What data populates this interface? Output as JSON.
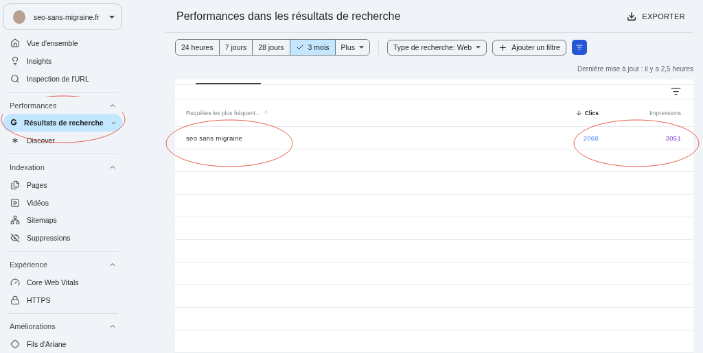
{
  "property": {
    "name": "seo-sans-migraine.fr"
  },
  "sidebar": {
    "top_items": [
      {
        "label": "Vue d'ensemble",
        "selected": false
      },
      {
        "label": "Insights",
        "selected": false
      },
      {
        "label": "Inspection de l'URL",
        "selected": false
      }
    ],
    "sections": [
      {
        "title": "Performances",
        "expanded": true,
        "items": [
          {
            "label": "Résultats de recherche",
            "selected": true
          },
          {
            "label": "Discover",
            "selected": false
          }
        ]
      },
      {
        "title": "Indexation",
        "expanded": true,
        "items": [
          {
            "label": "Pages",
            "selected": false
          },
          {
            "label": "Vidéos",
            "selected": false
          },
          {
            "label": "Sitemaps",
            "selected": false
          },
          {
            "label": "Suppressions",
            "selected": false
          }
        ]
      },
      {
        "title": "Expérience",
        "expanded": true,
        "items": [
          {
            "label": "Core Web Vitals",
            "selected": false
          },
          {
            "label": "HTTPS",
            "selected": false
          }
        ]
      },
      {
        "title": "Améliorations",
        "expanded": true,
        "items": [
          {
            "label": "Fils d'Ariane",
            "selected": false
          }
        ]
      }
    ]
  },
  "header": {
    "title": "Performances dans les résultats de recherche",
    "export_label": "EXPORTER"
  },
  "date_ranges": [
    {
      "label": "24 heures",
      "selected": false
    },
    {
      "label": "7 jours",
      "selected": false
    },
    {
      "label": "28 jours",
      "selected": false
    },
    {
      "label": "3 mois",
      "selected": true
    },
    {
      "label": "Plus",
      "selected": false
    }
  ],
  "filters": {
    "search_type": "Type de recherche: Web",
    "add_filter": "Ajouter un filtre"
  },
  "last_update": "Dernière mise à jour : il y a 2,5 heures",
  "table": {
    "columns": [
      {
        "label": "Requêtes les plus fréquent..."
      },
      {
        "label": "Clics"
      },
      {
        "label": "Impressions"
      }
    ],
    "rows": [
      [
        "seo sans migraine",
        "2068",
        "3051"
      ]
    ]
  }
}
